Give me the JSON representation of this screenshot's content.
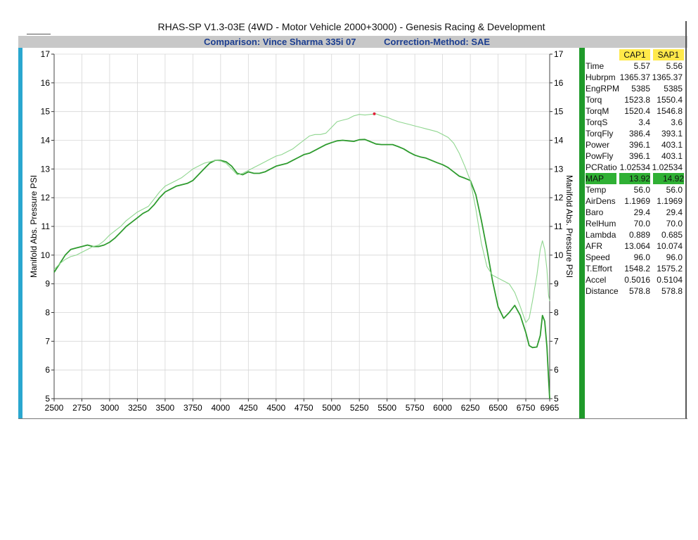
{
  "header": {
    "title": "RHAS-SP V1.3-03E  (4WD - Motor Vehicle 2000+3000) - Genesis Racing & Development",
    "comparison": "Comparison: Vince Sharma 335i 07",
    "correction": "Correction-Method: SAE"
  },
  "colors": {
    "cap1_line": "#2e9b2e",
    "sap1_line": "#8fd68f",
    "marker": "#e0203a"
  },
  "chart_data": {
    "type": "line",
    "ylabel": "Manifold Abs. Pressure PSI",
    "ylabel_right": "Manifold Abs. Pressure PSI",
    "xlim": [
      2500,
      6965
    ],
    "ylim": [
      5,
      17
    ],
    "x_ticks": [
      "2500",
      "2750",
      "3000",
      "3250",
      "3500",
      "3750",
      "4000",
      "4250",
      "4500",
      "4750",
      "5000",
      "5250",
      "5500",
      "5750",
      "6000",
      "6250",
      "6500",
      "6750",
      "6965"
    ],
    "y_ticks": [
      "5",
      "6",
      "7",
      "8",
      "9",
      "10",
      "11",
      "12",
      "13",
      "14",
      "15",
      "16",
      "17"
    ],
    "grid": true,
    "marker_point": {
      "x": 5385,
      "y": 14.92
    },
    "series": [
      {
        "name": "CAP1",
        "points": [
          [
            2500,
            9.4
          ],
          [
            2550,
            9.7
          ],
          [
            2600,
            10.0
          ],
          [
            2650,
            10.2
          ],
          [
            2700,
            10.25
          ],
          [
            2750,
            10.3
          ],
          [
            2800,
            10.35
          ],
          [
            2850,
            10.3
          ],
          [
            2900,
            10.3
          ],
          [
            2950,
            10.35
          ],
          [
            3000,
            10.45
          ],
          [
            3050,
            10.6
          ],
          [
            3100,
            10.8
          ],
          [
            3150,
            11.0
          ],
          [
            3200,
            11.15
          ],
          [
            3250,
            11.3
          ],
          [
            3300,
            11.45
          ],
          [
            3350,
            11.55
          ],
          [
            3400,
            11.75
          ],
          [
            3450,
            12.0
          ],
          [
            3500,
            12.2
          ],
          [
            3550,
            12.3
          ],
          [
            3600,
            12.4
          ],
          [
            3650,
            12.45
          ],
          [
            3700,
            12.5
          ],
          [
            3750,
            12.6
          ],
          [
            3800,
            12.8
          ],
          [
            3850,
            13.0
          ],
          [
            3900,
            13.2
          ],
          [
            3950,
            13.3
          ],
          [
            4000,
            13.3
          ],
          [
            4050,
            13.25
          ],
          [
            4100,
            13.1
          ],
          [
            4150,
            12.85
          ],
          [
            4200,
            12.8
          ],
          [
            4250,
            12.9
          ],
          [
            4300,
            12.85
          ],
          [
            4350,
            12.85
          ],
          [
            4400,
            12.9
          ],
          [
            4450,
            13.0
          ],
          [
            4500,
            13.1
          ],
          [
            4550,
            13.15
          ],
          [
            4600,
            13.2
          ],
          [
            4650,
            13.3
          ],
          [
            4700,
            13.4
          ],
          [
            4750,
            13.5
          ],
          [
            4800,
            13.55
          ],
          [
            4850,
            13.65
          ],
          [
            4900,
            13.75
          ],
          [
            4950,
            13.85
          ],
          [
            5000,
            13.92
          ],
          [
            5050,
            13.98
          ],
          [
            5100,
            14.0
          ],
          [
            5150,
            13.98
          ],
          [
            5200,
            13.96
          ],
          [
            5250,
            14.02
          ],
          [
            5300,
            14.03
          ],
          [
            5350,
            13.95
          ],
          [
            5400,
            13.87
          ],
          [
            5450,
            13.85
          ],
          [
            5500,
            13.85
          ],
          [
            5550,
            13.85
          ],
          [
            5600,
            13.78
          ],
          [
            5650,
            13.7
          ],
          [
            5700,
            13.58
          ],
          [
            5750,
            13.48
          ],
          [
            5800,
            13.42
          ],
          [
            5850,
            13.38
          ],
          [
            5900,
            13.3
          ],
          [
            5950,
            13.22
          ],
          [
            6000,
            13.15
          ],
          [
            6050,
            13.05
          ],
          [
            6100,
            12.9
          ],
          [
            6150,
            12.75
          ],
          [
            6200,
            12.68
          ],
          [
            6250,
            12.6
          ],
          [
            6300,
            12.1
          ],
          [
            6350,
            11.2
          ],
          [
            6400,
            10.2
          ],
          [
            6450,
            9.1
          ],
          [
            6500,
            8.2
          ],
          [
            6550,
            7.8
          ],
          [
            6600,
            8.0
          ],
          [
            6650,
            8.25
          ],
          [
            6700,
            7.9
          ],
          [
            6750,
            7.3
          ],
          [
            6780,
            6.85
          ],
          [
            6810,
            6.78
          ],
          [
            6850,
            6.8
          ],
          [
            6880,
            7.2
          ],
          [
            6900,
            7.9
          ],
          [
            6920,
            7.7
          ],
          [
            6940,
            6.8
          ],
          [
            6955,
            5.7
          ],
          [
            6965,
            5.0
          ]
        ]
      },
      {
        "name": "SAP1",
        "points": [
          [
            2500,
            9.5
          ],
          [
            2550,
            9.7
          ],
          [
            2600,
            9.85
          ],
          [
            2650,
            9.95
          ],
          [
            2700,
            10.0
          ],
          [
            2750,
            10.1
          ],
          [
            2800,
            10.2
          ],
          [
            2850,
            10.3
          ],
          [
            2900,
            10.35
          ],
          [
            2950,
            10.5
          ],
          [
            3000,
            10.7
          ],
          [
            3050,
            10.85
          ],
          [
            3100,
            11.0
          ],
          [
            3150,
            11.2
          ],
          [
            3200,
            11.35
          ],
          [
            3250,
            11.5
          ],
          [
            3300,
            11.6
          ],
          [
            3350,
            11.7
          ],
          [
            3400,
            11.95
          ],
          [
            3450,
            12.2
          ],
          [
            3500,
            12.4
          ],
          [
            3550,
            12.5
          ],
          [
            3600,
            12.6
          ],
          [
            3650,
            12.7
          ],
          [
            3700,
            12.85
          ],
          [
            3750,
            13.0
          ],
          [
            3800,
            13.1
          ],
          [
            3850,
            13.2
          ],
          [
            3900,
            13.25
          ],
          [
            3950,
            13.3
          ],
          [
            4000,
            13.28
          ],
          [
            4050,
            13.2
          ],
          [
            4100,
            13.0
          ],
          [
            4150,
            12.8
          ],
          [
            4200,
            12.85
          ],
          [
            4250,
            12.95
          ],
          [
            4300,
            13.05
          ],
          [
            4350,
            13.15
          ],
          [
            4400,
            13.25
          ],
          [
            4450,
            13.35
          ],
          [
            4500,
            13.45
          ],
          [
            4550,
            13.5
          ],
          [
            4600,
            13.6
          ],
          [
            4650,
            13.7
          ],
          [
            4700,
            13.85
          ],
          [
            4750,
            14.0
          ],
          [
            4800,
            14.15
          ],
          [
            4850,
            14.2
          ],
          [
            4900,
            14.2
          ],
          [
            4950,
            14.25
          ],
          [
            5000,
            14.45
          ],
          [
            5050,
            14.65
          ],
          [
            5100,
            14.7
          ],
          [
            5150,
            14.75
          ],
          [
            5200,
            14.85
          ],
          [
            5250,
            14.9
          ],
          [
            5300,
            14.88
          ],
          [
            5350,
            14.9
          ],
          [
            5400,
            14.92
          ],
          [
            5450,
            14.85
          ],
          [
            5500,
            14.8
          ],
          [
            5550,
            14.72
          ],
          [
            5600,
            14.65
          ],
          [
            5650,
            14.6
          ],
          [
            5700,
            14.55
          ],
          [
            5750,
            14.5
          ],
          [
            5800,
            14.45
          ],
          [
            5850,
            14.4
          ],
          [
            5900,
            14.35
          ],
          [
            5950,
            14.3
          ],
          [
            6000,
            14.2
          ],
          [
            6050,
            14.1
          ],
          [
            6100,
            13.9
          ],
          [
            6150,
            13.55
          ],
          [
            6200,
            13.1
          ],
          [
            6250,
            12.6
          ],
          [
            6300,
            11.6
          ],
          [
            6350,
            10.4
          ],
          [
            6400,
            9.6
          ],
          [
            6450,
            9.3
          ],
          [
            6500,
            9.2
          ],
          [
            6550,
            9.1
          ],
          [
            6600,
            9.0
          ],
          [
            6650,
            8.7
          ],
          [
            6700,
            8.2
          ],
          [
            6750,
            7.65
          ],
          [
            6780,
            7.8
          ],
          [
            6810,
            8.4
          ],
          [
            6850,
            9.3
          ],
          [
            6880,
            10.2
          ],
          [
            6900,
            10.5
          ],
          [
            6920,
            10.2
          ],
          [
            6940,
            9.5
          ],
          [
            6955,
            8.6
          ],
          [
            6965,
            8.4
          ]
        ]
      }
    ]
  },
  "panel": {
    "headers": [
      "CAP1",
      "SAP1"
    ],
    "rows": [
      {
        "name": "Time",
        "cap": "5.57",
        "sap": "5.56"
      },
      {
        "name": "Hubrpm",
        "cap": "1365.37",
        "sap": "1365.37"
      },
      {
        "name": "EngRPM",
        "cap": "5385",
        "sap": "5385"
      },
      {
        "name": "Torq",
        "cap": "1523.8",
        "sap": "1550.4"
      },
      {
        "name": "TorqM",
        "cap": "1520.4",
        "sap": "1546.8"
      },
      {
        "name": "TorqS",
        "cap": "3.4",
        "sap": "3.6"
      },
      {
        "name": "TorqFly",
        "cap": "386.4",
        "sap": "393.1"
      },
      {
        "name": "Power",
        "cap": "396.1",
        "sap": "403.1"
      },
      {
        "name": "PowFly",
        "cap": "396.1",
        "sap": "403.1"
      },
      {
        "name": "PCRatio",
        "cap": "1.02534",
        "sap": "1.02534"
      },
      {
        "name": "MAP",
        "cap": "13.92",
        "sap": "14.92"
      },
      {
        "name": "Temp",
        "cap": "56.0",
        "sap": "56.0"
      },
      {
        "name": "AirDens",
        "cap": "1.1969",
        "sap": "1.1969"
      },
      {
        "name": "Baro",
        "cap": "29.4",
        "sap": "29.4"
      },
      {
        "name": "RelHum",
        "cap": "70.0",
        "sap": "70.0"
      },
      {
        "name": "Lambda",
        "cap": "0.889",
        "sap": "0.685"
      },
      {
        "name": "AFR",
        "cap": "13.064",
        "sap": "10.074"
      },
      {
        "name": "Speed",
        "cap": "96.0",
        "sap": "96.0"
      },
      {
        "name": "T.Effort",
        "cap": "1548.2",
        "sap": "1575.2"
      },
      {
        "name": "Accel",
        "cap": "0.5016",
        "sap": "0.5104"
      },
      {
        "name": "Distance",
        "cap": "578.8",
        "sap": "578.8"
      }
    ]
  }
}
